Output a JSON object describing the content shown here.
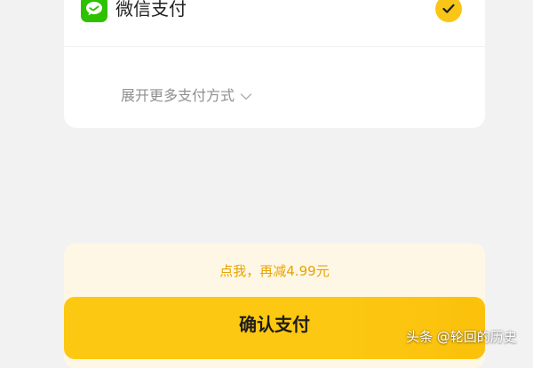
{
  "payment": {
    "method_label": "微信支付",
    "method_icon": "wechat-pay-icon",
    "selected_icon": "check-icon",
    "expand_label": "展开更多支付方式",
    "expand_icon": "chevron-down-icon"
  },
  "discount": {
    "text": "点我，再减4.99元"
  },
  "confirm": {
    "label": "确认支付"
  },
  "watermark": {
    "text": "头条 @轮回的历史"
  },
  "colors": {
    "background": "#f2f2f2",
    "card": "#ffffff",
    "wechat_green": "#2dc100",
    "accent_yellow": "#fcc812",
    "discount_text": "#e5a300",
    "discount_bg": "#fff7e6"
  }
}
